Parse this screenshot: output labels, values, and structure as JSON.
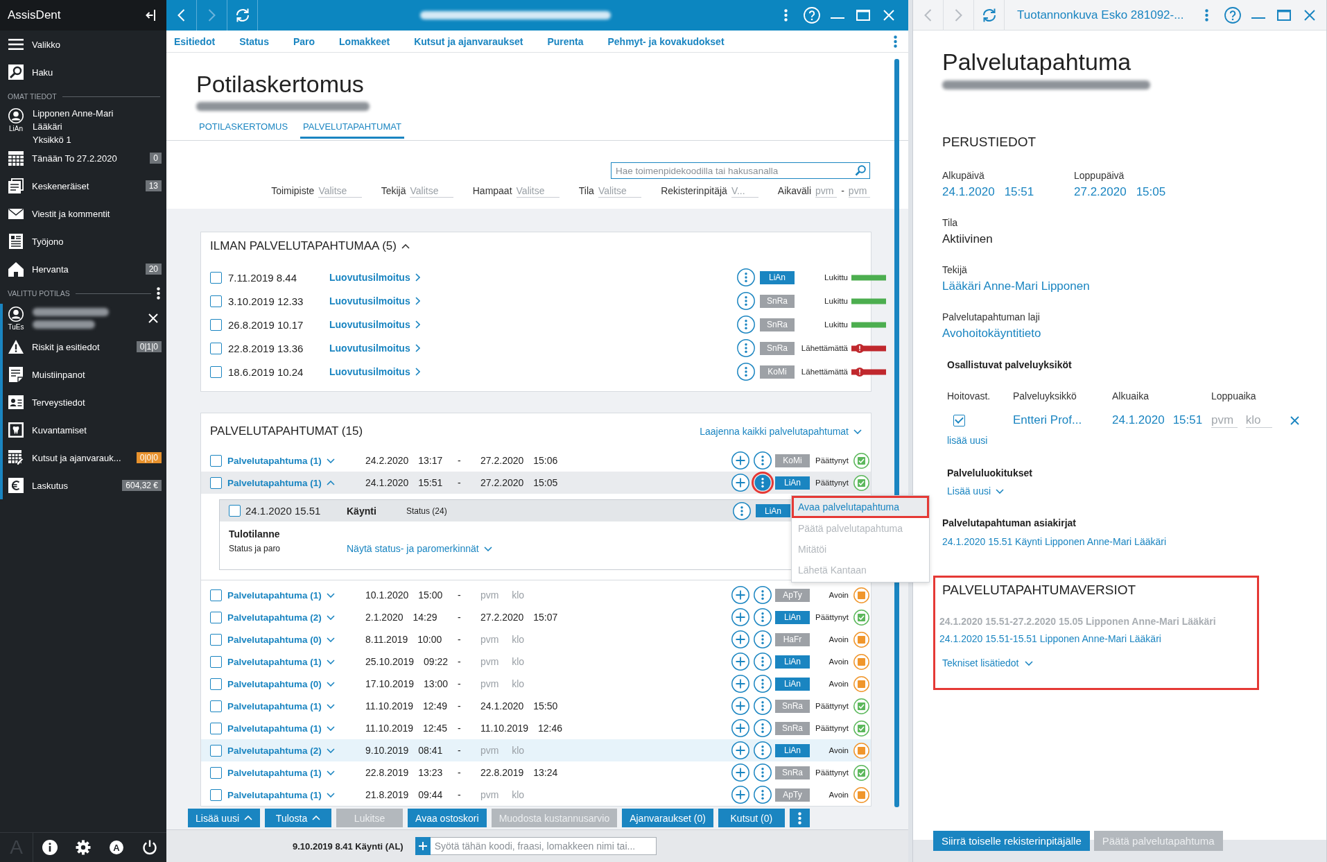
{
  "sidebar": {
    "title": "AssisDent",
    "nav": [
      {
        "label": "Valikko"
      },
      {
        "label": "Haku"
      }
    ],
    "own": {
      "heading": "OMAT TIEDOT",
      "user": {
        "initials": "LiAn",
        "lines": [
          "Lipponen Anne-Mari",
          "Lääkäri",
          "Yksikkö 1"
        ]
      },
      "items": [
        {
          "label": "Tänään To 27.2.2020",
          "badge": "0",
          "color": "#6f7479"
        },
        {
          "label": "Keskeneräiset",
          "badge": "13",
          "color": "#6f7479"
        },
        {
          "label": "Viestit ja kommentit"
        },
        {
          "label": "Työjono"
        },
        {
          "label": "Hervanta",
          "badge": "20",
          "color": "#6f7479"
        }
      ]
    },
    "patient": {
      "heading": "VALITTU POTILAS",
      "initials": "TuEs",
      "items": [
        {
          "label": "Riskit ja esitiedot",
          "badge": "0|1|0",
          "color": "#6f7479"
        },
        {
          "label": "Muistiinpanot"
        },
        {
          "label": "Terveystiedot"
        },
        {
          "label": "Kuvantamiset"
        },
        {
          "label": "Kutsut ja ajanvarauk...",
          "badge": "0|0|0",
          "color": "#e8922d"
        },
        {
          "label": "Laskutus",
          "badge": "604,32 €",
          "color": "#6f7479"
        }
      ]
    },
    "footer": {
      "logo": "A",
      "account": "A"
    }
  },
  "main": {
    "nav_buttons": [
      {
        "disabled": false
      },
      {
        "disabled": true
      }
    ],
    "tabs": [
      "Esitiedot",
      "Status",
      "Paro",
      "Lomakkeet",
      "Kutsut ja ajanvaraukset",
      "Purenta",
      "Pehmyt- ja kovakudokset"
    ],
    "title": "Potilaskertomus",
    "view_tabs": [
      {
        "label": "POTILASKERTOMUS",
        "selected": false
      },
      {
        "label": "PALVELUTAPAHTUMAT",
        "selected": true
      }
    ],
    "search": {
      "placeholder": "Hae toimenpidekoodilla tai hakusanalla"
    },
    "filters": [
      {
        "kind": "select",
        "label": "Toimipiste",
        "placeholder": "Valitse"
      },
      {
        "kind": "select",
        "label": "Tekijä",
        "placeholder": "Valitse"
      },
      {
        "kind": "select",
        "label": "Hampaat",
        "placeholder": "Valitse"
      },
      {
        "kind": "select",
        "label": "Tila",
        "placeholder": "Valitse"
      },
      {
        "kind": "select",
        "label": "Rekisterinpitäjä",
        "placeholder": "V..."
      },
      {
        "kind": "range",
        "label": "Aikaväli",
        "from": {
          "placeholder": "pvm"
        },
        "separator": "-",
        "to": {
          "placeholder": "pvm"
        }
      }
    ],
    "unlinked": {
      "title": "ILMAN PALVELUTAPAHTUMAA (5)",
      "expanded": true,
      "rows": [
        {
          "kind": "locked",
          "checked": false,
          "date": "7.11.2019 8.44",
          "link": "Luovutusilmoitus",
          "author": "LiAn",
          "color": "#1a85c1",
          "status": "Lukittu"
        },
        {
          "kind": "locked",
          "checked": false,
          "date": "3.10.2019 12.33",
          "link": "Luovutusilmoitus",
          "author": "SnRa",
          "color": "#9da1a6",
          "status": "Lukittu"
        },
        {
          "kind": "locked",
          "checked": false,
          "date": "26.8.2019 10.17",
          "link": "Luovutusilmoitus",
          "author": "SnRa",
          "color": "#9da1a6",
          "status": "Lukittu"
        },
        {
          "kind": "unsent",
          "checked": false,
          "date": "22.8.2019 13.36",
          "link": "Luovutusilmoitus",
          "author": "SnRa",
          "color": "#9da1a6",
          "status": "Lähettämättä"
        },
        {
          "kind": "unsent",
          "checked": false,
          "date": "18.6.2019 10.24",
          "link": "Luovutusilmoitus",
          "author": "KoMi",
          "color": "#9da1a6",
          "status": "Lähettämättä"
        }
      ]
    },
    "events": {
      "title": "PALVELUTAPAHTUMAT (15)",
      "expand_all": "Laajenna kaikki palvelutapahtumat",
      "rows": [
        {
          "kind": "ended",
          "checked": false,
          "link": "Palvelutapahtuma (1)",
          "expanded": false,
          "start_date": "24.2.2020",
          "start_time": "13:17",
          "separator": "-",
          "end_date": {
            "value": "27.2.2020"
          },
          "end_time": {
            "value": "15:06"
          },
          "author": "KoMi",
          "color": "#9da1a6",
          "status": "Päättynyt",
          "selected": false,
          "menu_open": false
        },
        {
          "kind": "ended",
          "checked": false,
          "link": "Palvelutapahtuma (1)",
          "expanded": true,
          "start_date": "24.1.2020",
          "start_time": "15:51",
          "separator": "-",
          "end_date": {
            "value": "27.2.2020"
          },
          "end_time": {
            "value": "15:05"
          },
          "author": "LiAn",
          "color": "#1a85c1",
          "status": "Päättynyt",
          "selected": false,
          "menu_open": true,
          "detail": {
            "checked": false,
            "date": "24.1.2020 15.51",
            "type": "Käynti",
            "status": "Status (24)",
            "author": "LiAn",
            "color": "#1a85c1",
            "section": "Tulotilanne",
            "field": "Status ja paro",
            "link": "Näytä status- ja paromerkinnät"
          }
        },
        {
          "kind": "open",
          "checked": false,
          "link": "Palvelutapahtuma (1)",
          "expanded": false,
          "start_date": "10.1.2020",
          "start_time": "15:00",
          "separator": "-",
          "end_date": {
            "placeholder": "pvm"
          },
          "end_time": {
            "placeholder": "klo"
          },
          "author": "ApTy",
          "color": "#9da1a6",
          "status": "Avoin",
          "selected": false,
          "menu_open": false
        },
        {
          "kind": "ended",
          "checked": false,
          "link": "Palvelutapahtuma (2)",
          "expanded": false,
          "start_date": "2.1.2020",
          "start_time": "14:29",
          "separator": "-",
          "end_date": {
            "value": "27.2.2020"
          },
          "end_time": {
            "value": "15:07"
          },
          "author": "LiAn",
          "color": "#1a85c1",
          "status": "Päättynyt",
          "selected": false,
          "menu_open": false
        },
        {
          "kind": "open",
          "checked": false,
          "link": "Palvelutapahtuma (0)",
          "expanded": false,
          "start_date": "8.11.2019",
          "start_time": "10:00",
          "separator": "-",
          "end_date": {
            "placeholder": "pvm"
          },
          "end_time": {
            "placeholder": "klo"
          },
          "author": "HaFr",
          "color": "#9da1a6",
          "status": "Avoin",
          "selected": false,
          "menu_open": false
        },
        {
          "kind": "open",
          "checked": false,
          "link": "Palvelutapahtuma (1)",
          "expanded": false,
          "start_date": "25.10.2019",
          "start_time": "09:22",
          "separator": "-",
          "end_date": {
            "placeholder": "pvm"
          },
          "end_time": {
            "placeholder": "klo"
          },
          "author": "LiAn",
          "color": "#1a85c1",
          "status": "Avoin",
          "selected": false,
          "menu_open": false
        },
        {
          "kind": "open",
          "checked": false,
          "link": "Palvelutapahtuma (0)",
          "expanded": false,
          "start_date": "17.10.2019",
          "start_time": "13:00",
          "separator": "-",
          "end_date": {
            "placeholder": "pvm"
          },
          "end_time": {
            "placeholder": "klo"
          },
          "author": "LiAn",
          "color": "#1a85c1",
          "status": "Avoin",
          "selected": false,
          "menu_open": false
        },
        {
          "kind": "ended",
          "checked": false,
          "link": "Palvelutapahtuma (1)",
          "expanded": false,
          "start_date": "11.10.2019",
          "start_time": "12:49",
          "separator": "-",
          "end_date": {
            "value": "24.1.2020"
          },
          "end_time": {
            "value": "15:50"
          },
          "author": "SnRa",
          "color": "#9da1a6",
          "status": "Päättynyt",
          "selected": false,
          "menu_open": false
        },
        {
          "kind": "ended",
          "checked": false,
          "link": "Palvelutapahtuma (1)",
          "expanded": false,
          "start_date": "11.10.2019",
          "start_time": "12:45",
          "separator": "-",
          "end_date": {
            "value": "11.10.2019"
          },
          "end_time": {
            "value": "12:46"
          },
          "author": "SnRa",
          "color": "#9da1a6",
          "status": "Päättynyt",
          "selected": false,
          "menu_open": false
        },
        {
          "kind": "open",
          "checked": false,
          "link": "Palvelutapahtuma (2)",
          "expanded": false,
          "start_date": "9.10.2019",
          "start_time": "08:41",
          "separator": "-",
          "end_date": {
            "placeholder": "pvm"
          },
          "end_time": {
            "placeholder": "klo"
          },
          "author": "LiAn",
          "color": "#1a85c1",
          "status": "Avoin",
          "selected": true,
          "menu_open": false
        },
        {
          "kind": "ended",
          "checked": false,
          "link": "Palvelutapahtuma (1)",
          "expanded": false,
          "start_date": "22.8.2019",
          "start_time": "13:23",
          "separator": "-",
          "end_date": {
            "value": "22.8.2019"
          },
          "end_time": {
            "value": "13:24"
          },
          "author": "SnRa",
          "color": "#9da1a6",
          "status": "Päättynyt",
          "selected": false,
          "menu_open": false
        },
        {
          "kind": "open",
          "checked": false,
          "link": "Palvelutapahtuma (1)",
          "expanded": false,
          "start_date": "21.8.2019",
          "start_time": "09:44",
          "separator": "-",
          "end_date": {
            "placeholder": "pvm"
          },
          "end_time": {
            "placeholder": "klo"
          },
          "author": "ApTy",
          "color": "#9da1a6",
          "status": "Avoin",
          "selected": false,
          "menu_open": false
        }
      ]
    },
    "actions": [
      {
        "label": "Lisää uusi",
        "dropdown": true,
        "disabled": false
      },
      {
        "label": "Tulosta",
        "dropdown": true,
        "disabled": false
      },
      {
        "label": "Lukitse",
        "dropdown": false,
        "disabled": true
      },
      {
        "label": "Avaa ostoskori",
        "dropdown": false,
        "disabled": false
      },
      {
        "label": "Muodosta kustannusarvio",
        "dropdown": false,
        "disabled": true
      },
      {
        "label": "Ajanvaraukset (0)",
        "dropdown": false,
        "disabled": false
      },
      {
        "label": "Kutsut (0)",
        "dropdown": false,
        "disabled": false
      }
    ],
    "status_line": "9.10.2019 8.41 Käynti (AL)",
    "entry": {
      "placeholder": "Syötä tähän koodi, fraasi, lomakkeen nimi tai..."
    }
  },
  "menu": {
    "items": [
      {
        "label": "Avaa palvelutapahtuma",
        "disabled": false,
        "highlighted": true
      },
      {
        "label": "Päätä palvelutapahtuma",
        "disabled": true,
        "highlighted": false
      },
      {
        "label": "Mitätöi",
        "disabled": true,
        "highlighted": false
      },
      {
        "label": "Lähetä Kantaan",
        "disabled": true,
        "highlighted": false
      }
    ]
  },
  "detail": {
    "nav_buttons": [
      {
        "disabled": true
      },
      {
        "disabled": true
      }
    ],
    "title": "Tuotannonkuva Esko 281092-...",
    "heading": "Palvelutapahtuma",
    "section": "PERUSTIEDOT",
    "start": {
      "label": "Alkupäivä",
      "date": "24.1.2020",
      "time": "15:51"
    },
    "end": {
      "label": "Loppupäivä",
      "date": "27.2.2020",
      "time": "15:05"
    },
    "fields": [
      {
        "kind": "text",
        "label": "Tila",
        "value": "Aktiivinen"
      },
      {
        "kind": "link",
        "label": "Tekijä",
        "value": "Lääkäri Anne-Mari Lipponen"
      },
      {
        "kind": "link",
        "label": "Palvelutapahtuman laji",
        "value": "Avohoitokäyntitieto"
      }
    ],
    "units": {
      "title": "Osallistuvat palveluyksiköt",
      "columns": [
        "Hoitovast.",
        "Palveluyksikkö",
        "Alkuaika",
        "Loppuaika"
      ],
      "rows": [
        {
          "checked": true,
          "unit": "Entteri Prof...",
          "start_date": "24.1.2020",
          "start_time": "15:51",
          "end_date": {
            "placeholder": "pvm"
          },
          "end_time": {
            "placeholder": "klo"
          }
        }
      ],
      "add": "lisää uusi"
    },
    "classifications": {
      "title": "Palveluluokitukset",
      "add": "Lisää uusi"
    },
    "documents": {
      "title": "Palvelutapahtuman asiakirjat",
      "items": [
        "24.1.2020 15.51 Käynti Lipponen Anne-Mari Lääkäri"
      ]
    },
    "versions": {
      "title": "PALVELUTAPAHTUMAVERSIOT",
      "highlighted": true,
      "items": [
        {
          "label": "24.1.2020 15.51-27.2.2020 15.05 Lipponen Anne-Mari Lääkäri",
          "selected": true
        },
        {
          "label": "24.1.2020 15.51-15.51 Lipponen Anne-Mari Lääkäri",
          "selected": false
        }
      ],
      "details": "Tekniset lisätiedot"
    },
    "buttons": [
      {
        "label": "Siirrä toiselle rekisterinpitäjälle",
        "disabled": false
      },
      {
        "label": "Päätä palvelutapahtuma",
        "disabled": true
      }
    ]
  }
}
